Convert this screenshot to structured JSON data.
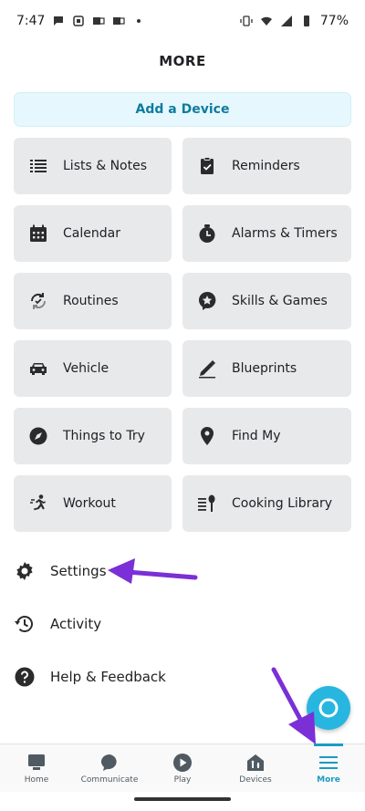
{
  "status_bar": {
    "time": "7:47",
    "battery": "77%"
  },
  "page": {
    "title": "MORE",
    "add_device_label": "Add a Device"
  },
  "tiles": [
    {
      "label": "Lists & Notes",
      "icon": "list-icon"
    },
    {
      "label": "Reminders",
      "icon": "clipboard-check-icon"
    },
    {
      "label": "Calendar",
      "icon": "calendar-icon"
    },
    {
      "label": "Alarms & Timers",
      "icon": "alarm-clock-icon"
    },
    {
      "label": "Routines",
      "icon": "routines-icon"
    },
    {
      "label": "Skills & Games",
      "icon": "star-bubble-icon"
    },
    {
      "label": "Vehicle",
      "icon": "car-icon"
    },
    {
      "label": "Blueprints",
      "icon": "pencil-icon"
    },
    {
      "label": "Things to Try",
      "icon": "compass-icon"
    },
    {
      "label": "Find My",
      "icon": "location-pin-icon"
    },
    {
      "label": "Workout",
      "icon": "running-icon"
    },
    {
      "label": "Cooking Library",
      "icon": "cooking-library-icon"
    }
  ],
  "menu": [
    {
      "label": "Settings",
      "icon": "gear-icon"
    },
    {
      "label": "Activity",
      "icon": "history-icon"
    },
    {
      "label": "Help & Feedback",
      "icon": "help-icon"
    }
  ],
  "bottom_nav": [
    {
      "label": "Home",
      "icon": "home-icon"
    },
    {
      "label": "Communicate",
      "icon": "chat-bubble-icon"
    },
    {
      "label": "Play",
      "icon": "play-icon"
    },
    {
      "label": "Devices",
      "icon": "devices-icon"
    },
    {
      "label": "More",
      "icon": "menu-icon",
      "active": true
    }
  ],
  "colors": {
    "accent": "#1a9bc2",
    "add_device_bg": "#e6f8fd",
    "tile_bg": "#e8e9eb",
    "annotation_arrow": "#7b2fd6",
    "alexa": "#27b6df"
  }
}
